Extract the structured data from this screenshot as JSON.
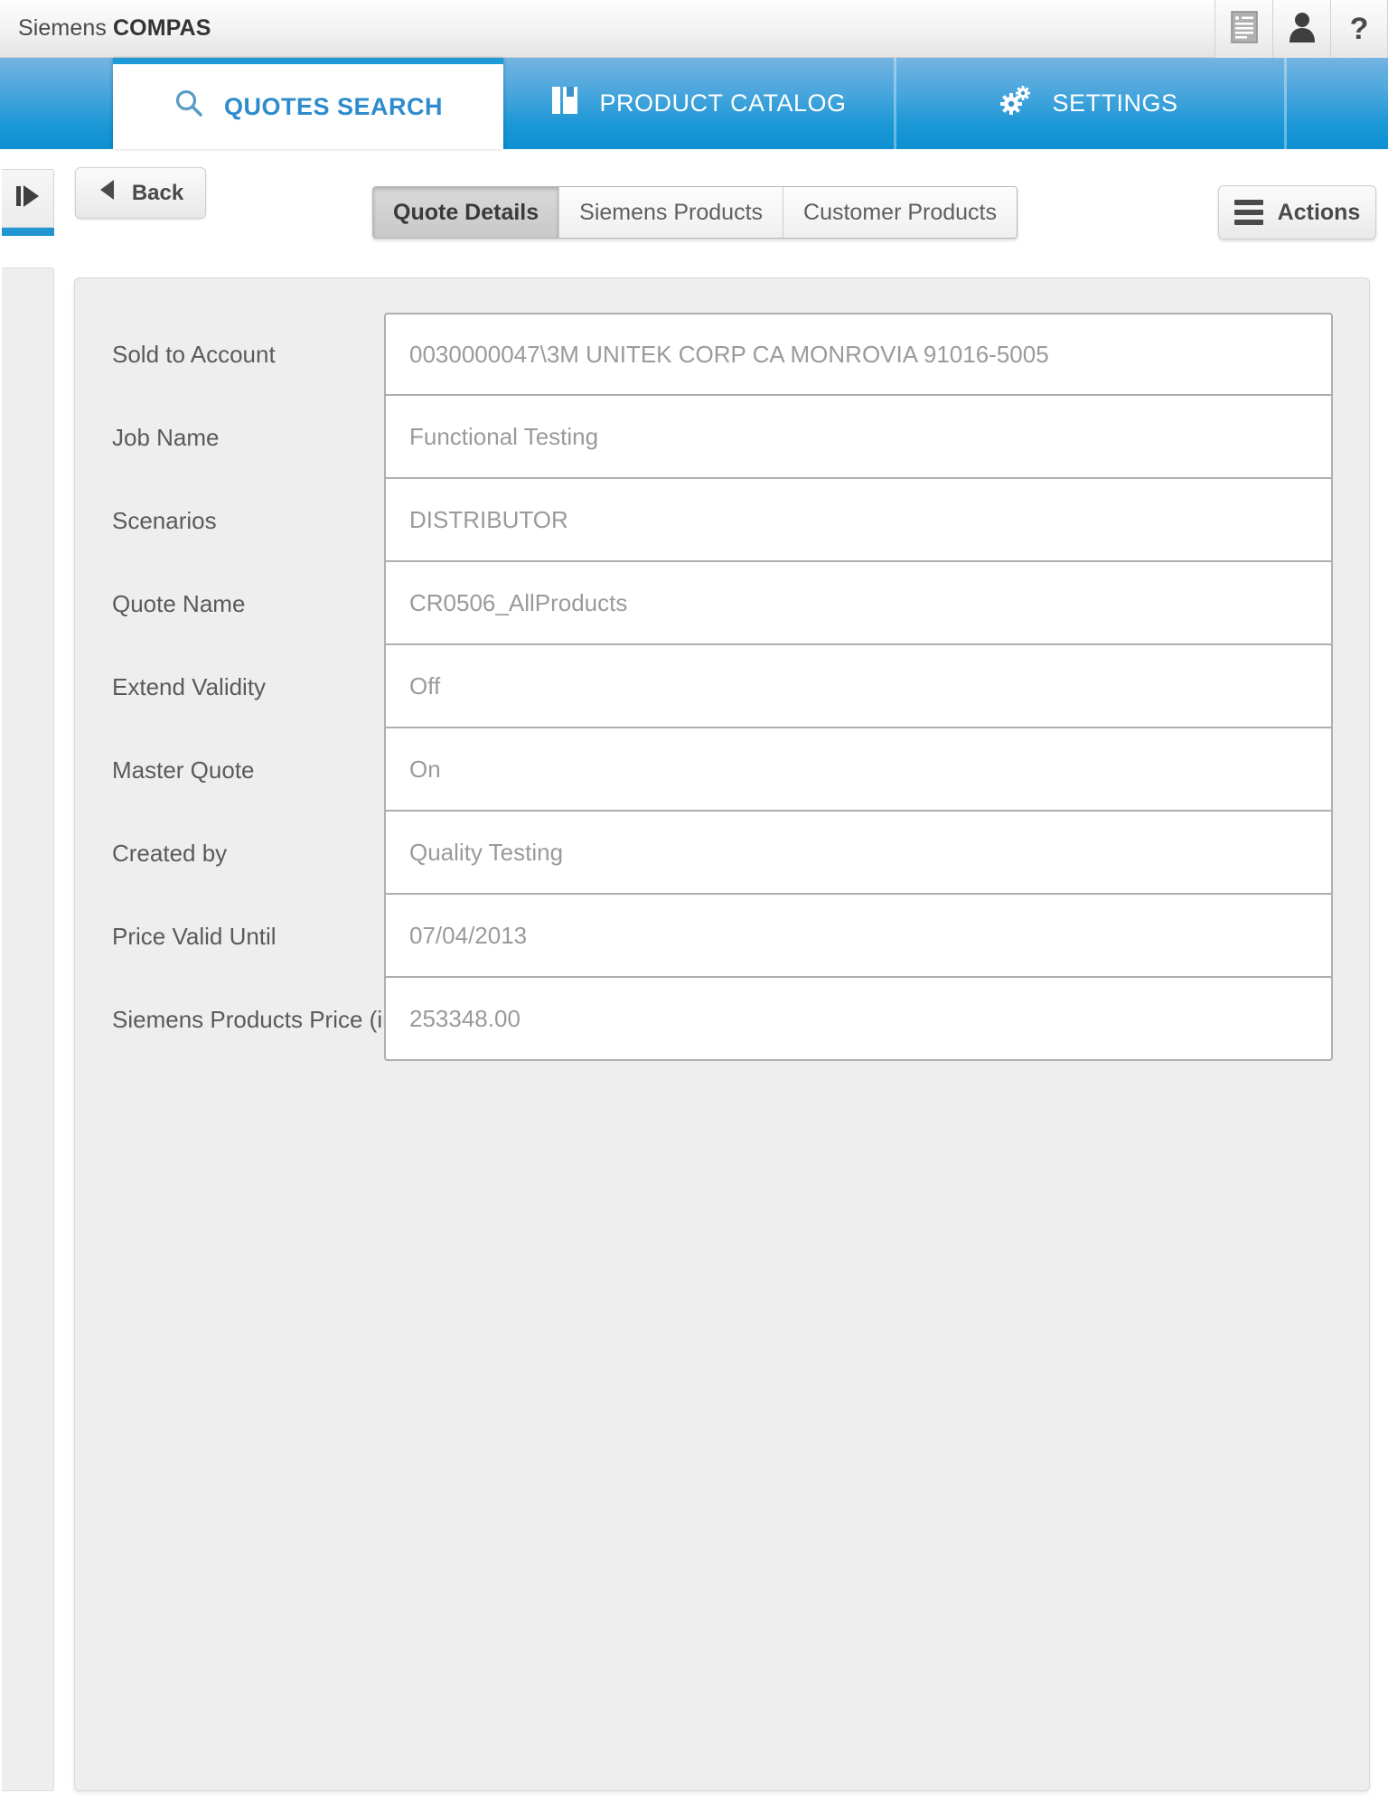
{
  "titlebar": {
    "app_name_regular": "Siemens ",
    "app_name_bold": "COMPAS",
    "icons": [
      {
        "name": "document-list-icon",
        "label": ""
      },
      {
        "name": "user-icon",
        "label": ""
      },
      {
        "name": "help-icon",
        "label": "?"
      }
    ]
  },
  "main_tabs": [
    {
      "label": "QUOTES SEARCH",
      "icon": "search-icon",
      "active": true
    },
    {
      "label": "PRODUCT CATALOG",
      "icon": "catalog-book-icon",
      "active": false
    },
    {
      "label": "SETTINGS",
      "icon": "gears-icon",
      "active": false
    }
  ],
  "toolbar": {
    "sidebar_toggle_icon": "expand-panel-icon",
    "back_label": "Back",
    "actions_label": "Actions",
    "actions_icon": "hamburger-icon"
  },
  "sub_tabs": [
    {
      "label": "Quote Details",
      "selected": true
    },
    {
      "label": "Siemens Products",
      "selected": false
    },
    {
      "label": "Customer Products",
      "selected": false
    }
  ],
  "form": {
    "rows": [
      {
        "label": "Sold to Account",
        "value": "0030000047\\3M UNITEK CORP   CA  MONROVIA  91016-5005"
      },
      {
        "label": "Job Name",
        "value": "Functional Testing"
      },
      {
        "label": "Scenarios",
        "value": "DISTRIBUTOR"
      },
      {
        "label": "Quote Name",
        "value": "CR0506_AllProducts"
      },
      {
        "label": "Extend Validity",
        "value": "Off"
      },
      {
        "label": "Master Quote",
        "value": "On"
      },
      {
        "label": "Created by",
        "value": "Quality Testing"
      },
      {
        "label": "Price Valid Until",
        "value": "07/04/2013"
      },
      {
        "label": "Siemens Products Price (in $)",
        "value": "253348.00"
      }
    ]
  },
  "colors": {
    "brand_blue": "#1a97d6",
    "active_tab_text": "#2e8ccc",
    "accent_underline": "#2196d3",
    "panel_bg": "#eeeeee",
    "value_text": "#9a9a9a",
    "label_text": "#5a5a5a"
  }
}
